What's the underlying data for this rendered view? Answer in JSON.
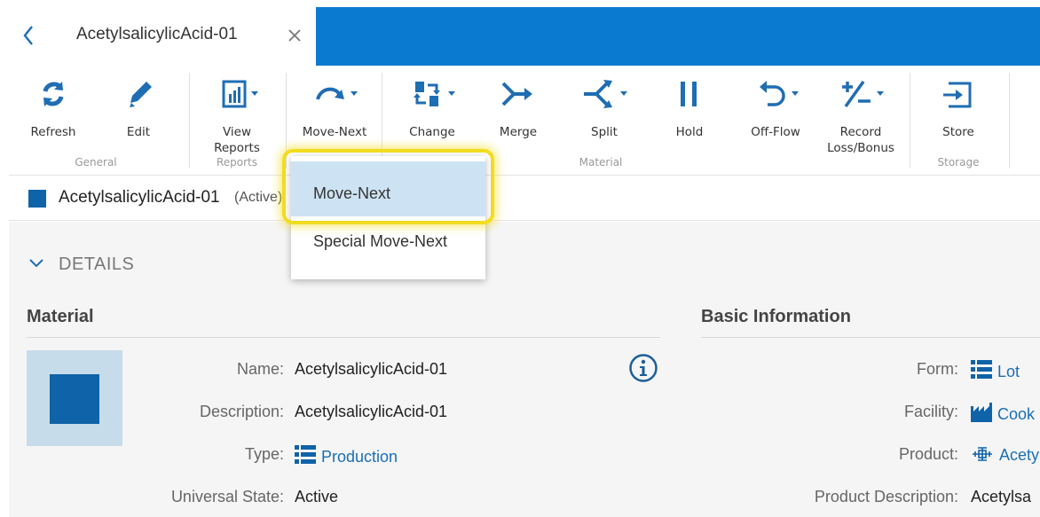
{
  "tab": {
    "title": "AcetylsalicylicAcid-01"
  },
  "ribbon": {
    "buttons": {
      "refresh": "Refresh",
      "edit": "Edit",
      "view_reports_1": "View",
      "view_reports_2": "Reports",
      "move_next": "Move-Next",
      "change": "Change",
      "merge": "Merge",
      "split": "Split",
      "hold": "Hold",
      "off_flow": "Off-Flow",
      "record_1": "Record",
      "record_2": "Loss/Bonus",
      "store": "Store"
    },
    "groups": {
      "general": "General",
      "reports": "Reports",
      "material": "Material",
      "storage": "Storage"
    }
  },
  "entity_header": {
    "name": "AcetylsalicylicAcid-01",
    "state": "(Active)"
  },
  "details": {
    "heading": "DETAILS",
    "material_section": {
      "title": "Material",
      "fields": [
        {
          "label": "Name:",
          "value": "AcetylsalicylicAcid-01"
        },
        {
          "label": "Description:",
          "value": "AcetylsalicylicAcid-01"
        },
        {
          "label": "Type:",
          "value": "Production"
        },
        {
          "label": "Universal State:",
          "value": "Active"
        }
      ]
    },
    "basic_section": {
      "title": "Basic Information",
      "fields": [
        {
          "label": "Form:",
          "value": "Lot"
        },
        {
          "label": "Facility:",
          "value": "Cook"
        },
        {
          "label": "Product:",
          "value": "Acety"
        },
        {
          "label": "Product Description:",
          "value": "Acetylsa"
        }
      ]
    }
  },
  "dropdown": {
    "items": [
      "Move-Next",
      "Special Move-Next"
    ]
  },
  "colors": {
    "accent": "#0a7ad0",
    "entity": "#0f63a8",
    "link": "#1a6fb5",
    "highlight": "#f2dc1f",
    "selected": "#cde3f4"
  }
}
